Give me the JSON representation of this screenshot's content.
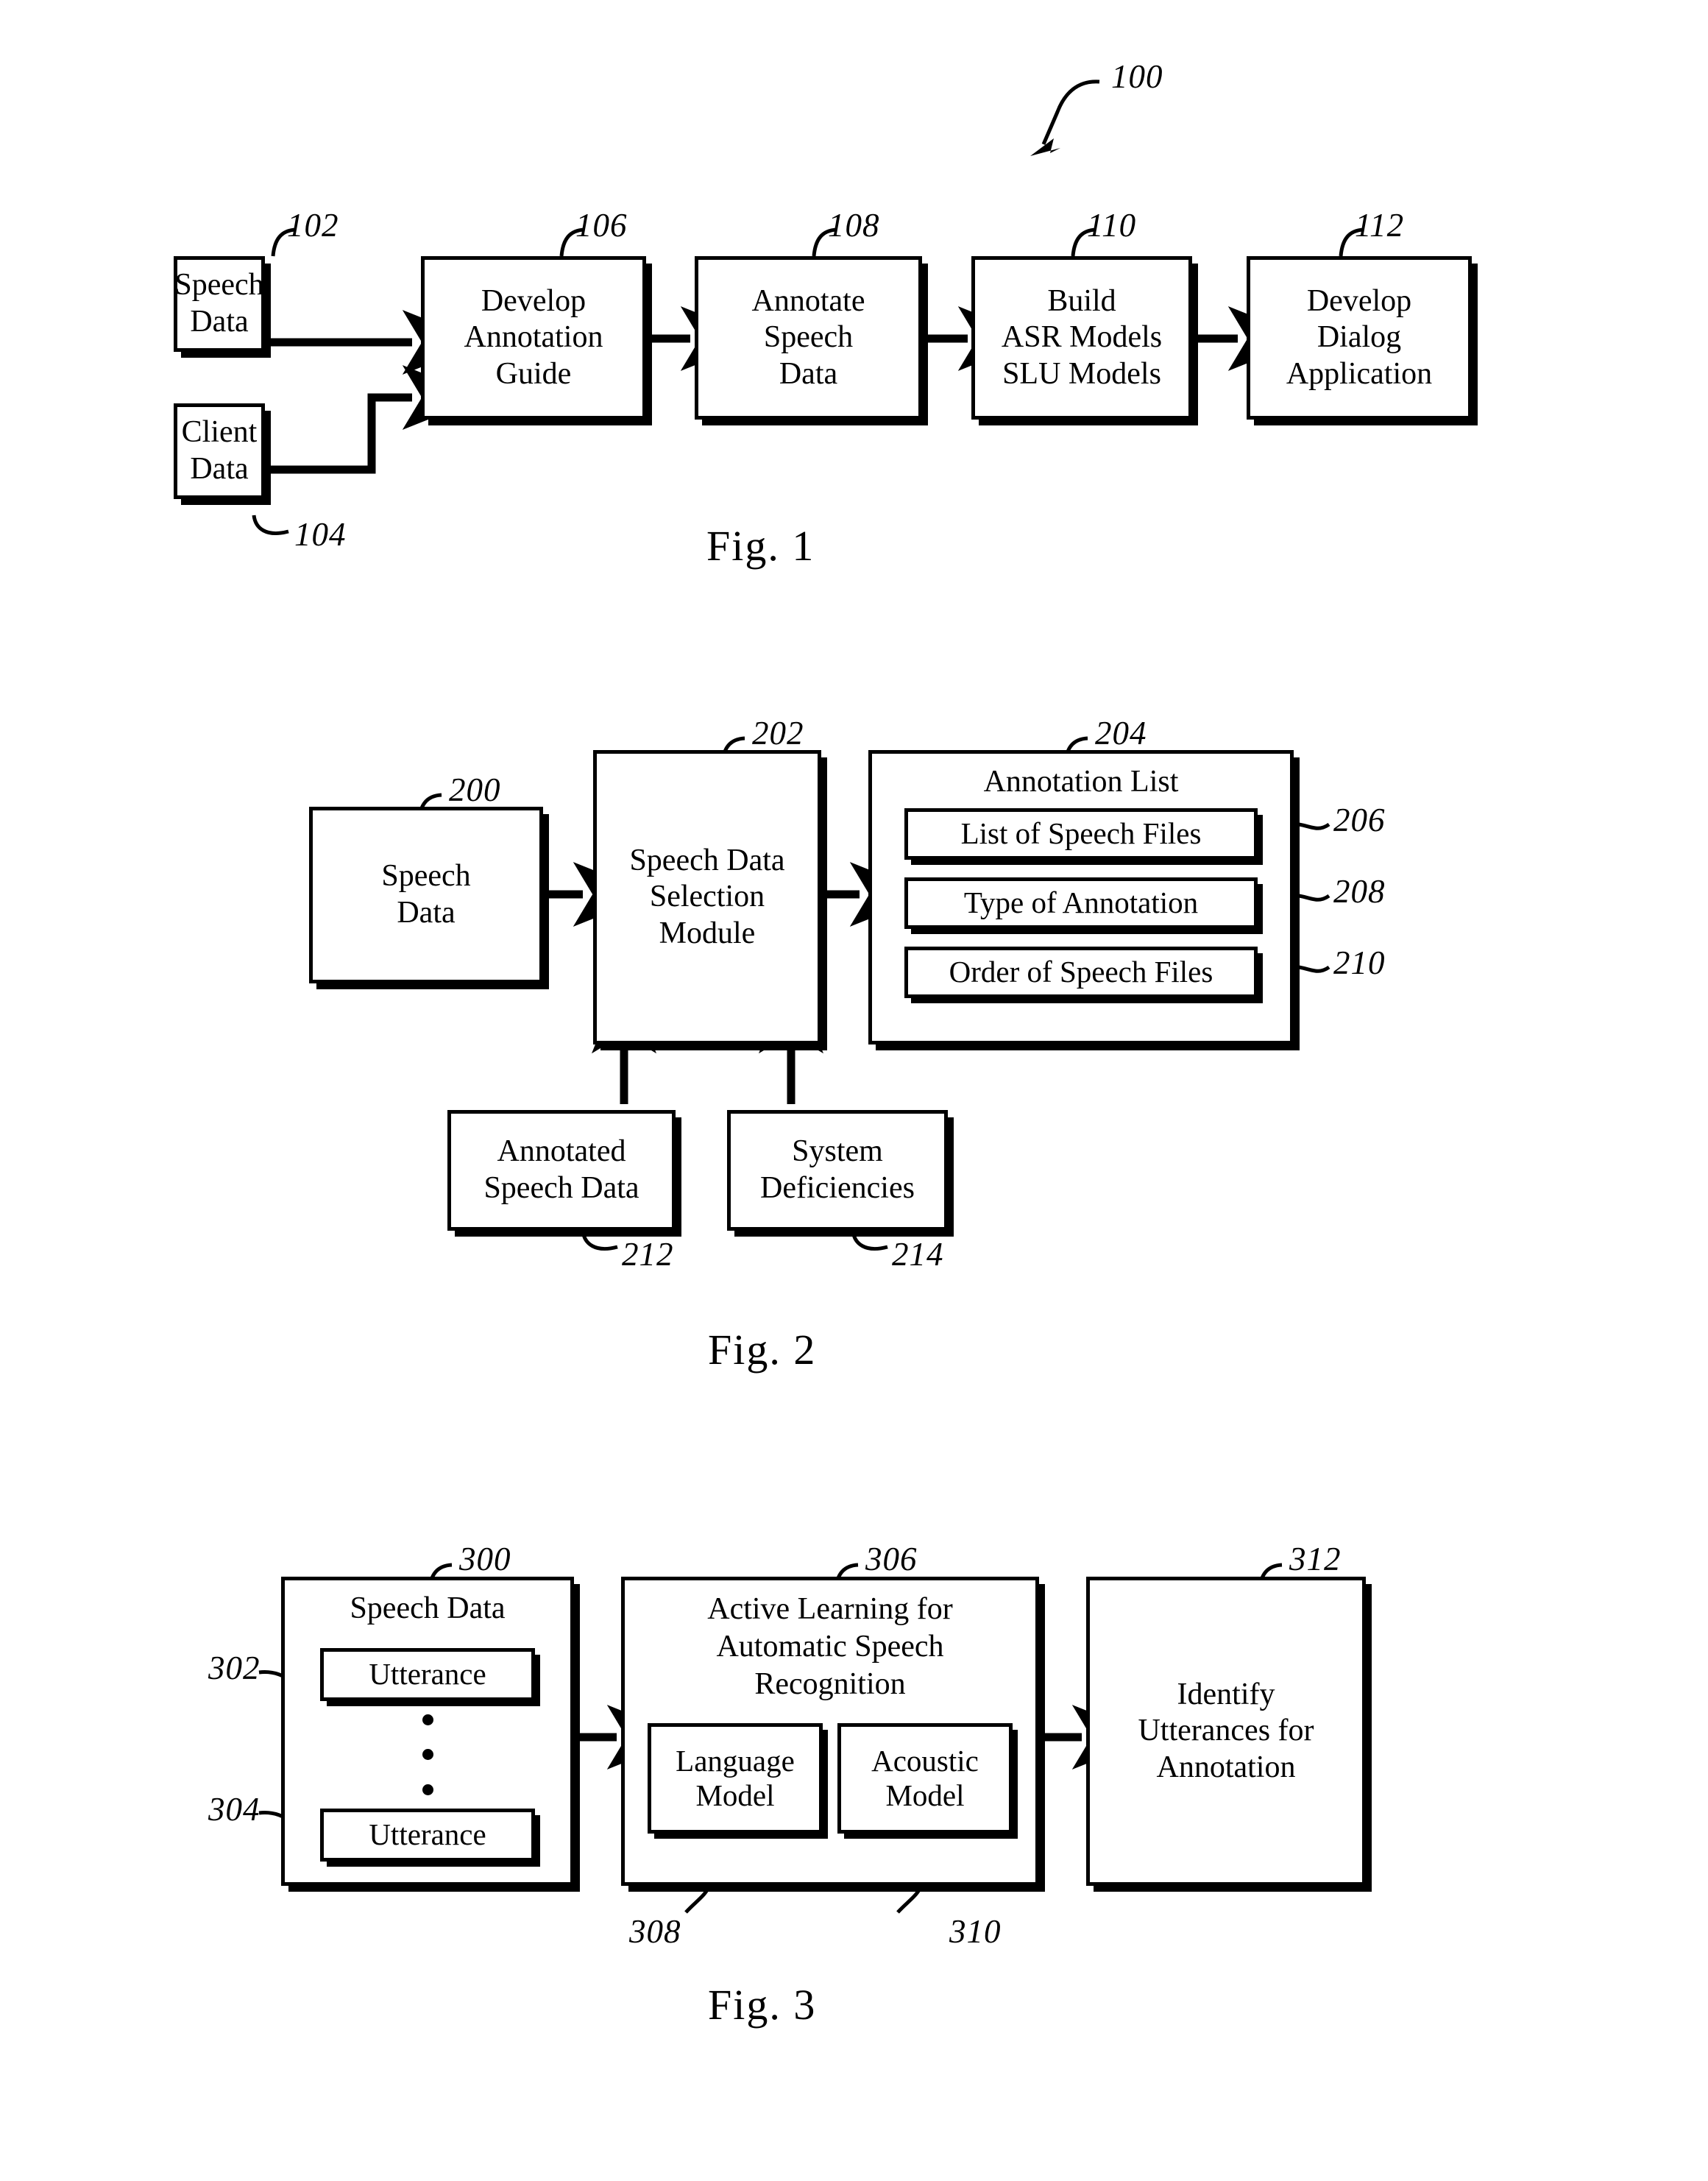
{
  "document": {
    "type": "patent-drawing-sheet",
    "figures": [
      {
        "caption": "Fig.  1",
        "system_ref": "100",
        "nodes": [
          {
            "ref": "102",
            "lines": [
              "Speech",
              "Data"
            ]
          },
          {
            "ref": "104",
            "lines": [
              "Client",
              "Data"
            ]
          },
          {
            "ref": "106",
            "lines": [
              "Develop",
              "Annotation",
              "Guide"
            ]
          },
          {
            "ref": "108",
            "lines": [
              "Annotate",
              "Speech",
              "Data"
            ]
          },
          {
            "ref": "110",
            "lines": [
              "Build",
              "ASR Models",
              "SLU Models"
            ]
          },
          {
            "ref": "112",
            "lines": [
              "Develop",
              "Dialog",
              "Application"
            ]
          }
        ]
      },
      {
        "caption": "Fig.  2",
        "nodes": [
          {
            "ref": "200",
            "lines": [
              "Speech",
              "Data"
            ]
          },
          {
            "ref": "202",
            "lines": [
              "Speech Data",
              "Selection",
              "Module"
            ]
          },
          {
            "ref": "204",
            "header": "Annotation List",
            "items": [
              {
                "ref": "206",
                "label": "List of Speech Files"
              },
              {
                "ref": "208",
                "label": "Type of Annotation"
              },
              {
                "ref": "210",
                "label": "Order of Speech Files"
              }
            ]
          },
          {
            "ref": "212",
            "lines": [
              "Annotated",
              "Speech Data"
            ]
          },
          {
            "ref": "214",
            "lines": [
              "System",
              "Deficiencies"
            ]
          }
        ]
      },
      {
        "caption": "Fig.  3",
        "nodes": [
          {
            "ref": "300",
            "header": "Speech Data",
            "items": [
              {
                "ref": "302",
                "label": "Utterance"
              },
              {
                "ref": "304",
                "label": "Utterance"
              }
            ],
            "ellipsis": "⋮"
          },
          {
            "ref": "306",
            "lines": [
              "Active Learning for",
              "Automatic Speech",
              "Recognition"
            ],
            "items": [
              {
                "ref": "308",
                "lines": [
                  "Language",
                  "Model"
                ]
              },
              {
                "ref": "310",
                "lines": [
                  "Acoustic",
                  "Model"
                ]
              }
            ]
          },
          {
            "ref": "312",
            "lines": [
              "Identify",
              "Utterances for",
              "Annotation"
            ]
          }
        ]
      }
    ]
  },
  "fig1": {
    "caption": "Fig.  1",
    "ref_system": "100",
    "speech_data": {
      "ref": "102",
      "l1": "Speech",
      "l2": "Data"
    },
    "client_data": {
      "ref": "104",
      "l1": "Client",
      "l2": "Data"
    },
    "develop_guide": {
      "ref": "106",
      "l1": "Develop",
      "l2": "Annotation",
      "l3": "Guide"
    },
    "annotate": {
      "ref": "108",
      "l1": "Annotate",
      "l2": "Speech",
      "l3": "Data"
    },
    "build": {
      "ref": "110",
      "l1": "Build",
      "l2": "ASR Models",
      "l3": "SLU Models"
    },
    "dialog": {
      "ref": "112",
      "l1": "Develop",
      "l2": "Dialog",
      "l3": "Application"
    }
  },
  "fig2": {
    "caption": "Fig.  2",
    "speech_data": {
      "ref": "200",
      "l1": "Speech",
      "l2": "Data"
    },
    "selection_module": {
      "ref": "202",
      "l1": "Speech Data",
      "l2": "Selection",
      "l3": "Module"
    },
    "annotation_list": {
      "ref": "204",
      "header": "Annotation List",
      "item1": {
        "ref": "206",
        "label": "List of Speech Files"
      },
      "item2": {
        "ref": "208",
        "label": "Type of Annotation"
      },
      "item3": {
        "ref": "210",
        "label": "Order of Speech Files"
      }
    },
    "annotated_speech": {
      "ref": "212",
      "l1": "Annotated",
      "l2": "Speech Data"
    },
    "system_deficiencies": {
      "ref": "214",
      "l1": "System",
      "l2": "Deficiencies"
    }
  },
  "fig3": {
    "caption": "Fig.  3",
    "speech_data": {
      "ref": "300",
      "header": "Speech Data",
      "utt1": {
        "ref": "302",
        "label": "Utterance"
      },
      "utt2": {
        "ref": "304",
        "label": "Utterance"
      }
    },
    "active_learning": {
      "ref": "306",
      "l1": "Active Learning for",
      "l2": "Automatic Speech",
      "l3": "Recognition",
      "language_model": {
        "ref": "308",
        "l1": "Language",
        "l2": "Model"
      },
      "acoustic_model": {
        "ref": "310",
        "l1": "Acoustic",
        "l2": "Model"
      }
    },
    "identify": {
      "ref": "312",
      "l1": "Identify",
      "l2": "Utterances for",
      "l3": "Annotation"
    }
  },
  "colors": {
    "ink": "#000000",
    "paper": "#ffffff"
  }
}
